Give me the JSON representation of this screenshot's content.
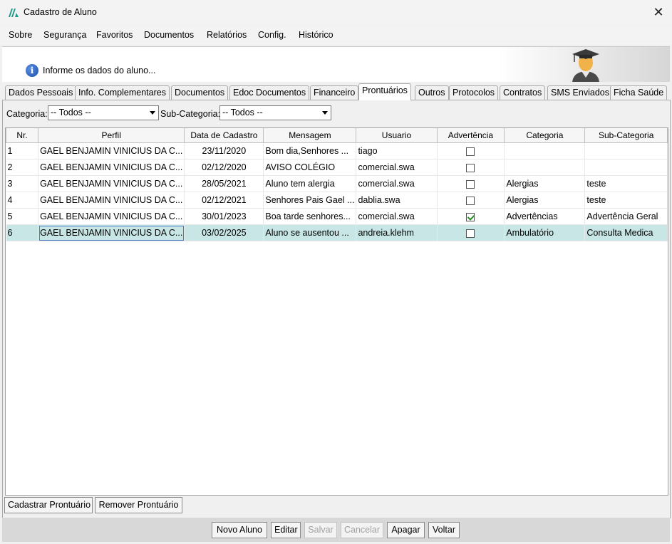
{
  "window": {
    "title": "Cadastro de Aluno"
  },
  "menu": [
    "Sobre",
    "Segurança",
    "Favoritos",
    "Documentos",
    "Relatórios",
    "Config.",
    "Histórico"
  ],
  "header": {
    "info_text": "Informe os dados do aluno..."
  },
  "tabs": [
    "Dados Pessoais",
    "Info. Complementares",
    "Documentos",
    "Edoc Documentos",
    "Financeiro",
    "Prontuários",
    "Outros",
    "Protocolos",
    "Contratos",
    "SMS Enviados",
    "Ficha Saúde"
  ],
  "active_tab": "Prontuários",
  "filters": {
    "categoria_label": "Categoria:",
    "categoria_value": "-- Todos --",
    "subcategoria_label": "Sub-Categoria:",
    "subcategoria_value": "-- Todos --"
  },
  "table": {
    "columns": [
      "Nr.",
      "Perfil",
      "Data de Cadastro",
      "Mensagem",
      "Usuario",
      "Advertência",
      "Categoria",
      "Sub-Categoria"
    ],
    "rows": [
      {
        "nr": "1",
        "perfil": "GAEL BENJAMIN VINICIUS DA C...",
        "data": "23/11/2020",
        "mensagem": "Bom dia,Senhores ...",
        "usuario": "tiago",
        "advertencia": false,
        "categoria": "",
        "subcategoria": ""
      },
      {
        "nr": "2",
        "perfil": "GAEL BENJAMIN VINICIUS DA C...",
        "data": "02/12/2020",
        "mensagem": "AVISO COLÉGIO",
        "usuario": "comercial.swa",
        "advertencia": false,
        "categoria": "",
        "subcategoria": ""
      },
      {
        "nr": "3",
        "perfil": "GAEL BENJAMIN VINICIUS DA C...",
        "data": "28/05/2021",
        "mensagem": "Aluno tem alergia",
        "usuario": "comercial.swa",
        "advertencia": false,
        "categoria": "Alergias",
        "subcategoria": "teste"
      },
      {
        "nr": "4",
        "perfil": "GAEL BENJAMIN VINICIUS DA C...",
        "data": "02/12/2021",
        "mensagem": "Senhores Pais Gael ...",
        "usuario": "dablia.swa",
        "advertencia": false,
        "categoria": "Alergias",
        "subcategoria": "teste"
      },
      {
        "nr": "5",
        "perfil": "GAEL BENJAMIN VINICIUS DA C...",
        "data": "30/01/2023",
        "mensagem": "Boa tarde senhores...",
        "usuario": "comercial.swa",
        "advertencia": true,
        "categoria": "Advertências",
        "subcategoria": "Advertência Geral"
      },
      {
        "nr": "6",
        "perfil": "GAEL BENJAMIN VINICIUS DA C...",
        "data": "03/02/2025",
        "mensagem": "Aluno se ausentou ...",
        "usuario": "andreia.klehm",
        "advertencia": false,
        "categoria": "Ambulatório",
        "subcategoria": "Consulta Medica"
      }
    ],
    "selected_row": 6
  },
  "panel_buttons": {
    "cadastrar": "Cadastrar Prontuário",
    "remover": "Remover Prontuário"
  },
  "footer_buttons": {
    "novo": "Novo Aluno",
    "editar": "Editar",
    "salvar": "Salvar",
    "cancelar": "Cancelar",
    "apagar": "Apagar",
    "voltar": "Voltar"
  },
  "colors": {
    "selected_row": "#c8e6e6",
    "checkbox_check": "#2a8a2a",
    "info_icon": "#1a4fb0"
  },
  "icons": {
    "app": "app-logo-icon",
    "close": "close-icon",
    "info": "info-icon",
    "avatar": "graduate-avatar-icon"
  }
}
